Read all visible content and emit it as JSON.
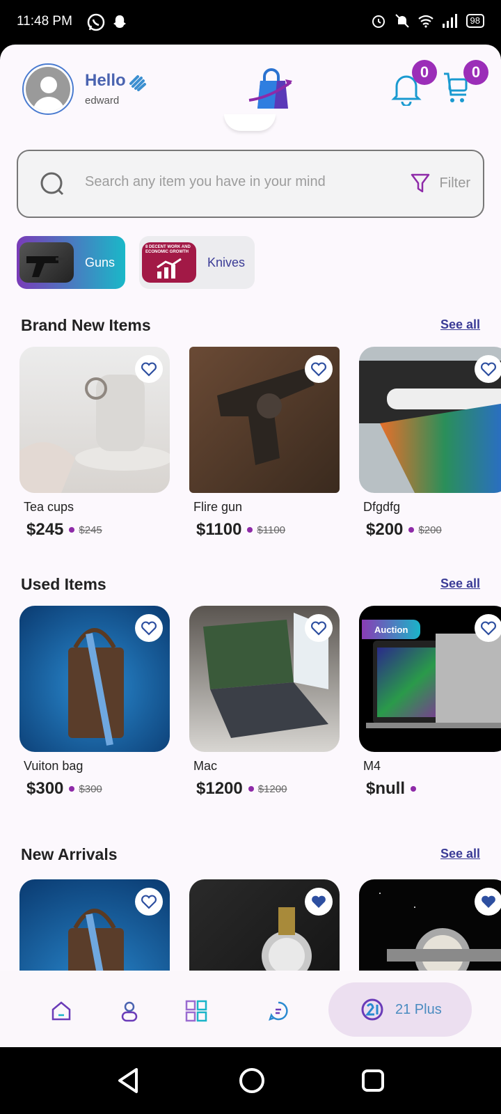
{
  "status": {
    "time": "11:48 PM",
    "battery": "98"
  },
  "header": {
    "greeting": "Hello",
    "user": "edward",
    "notifications_count": "0",
    "cart_count": "0"
  },
  "search": {
    "placeholder": "Search any item you have in your mind",
    "filter_label": "Filter"
  },
  "categories": [
    {
      "label": "Guns"
    },
    {
      "label": "Knives"
    }
  ],
  "sections": [
    {
      "title": "Brand New Items",
      "see_all": "See all",
      "items": [
        {
          "name": "Tea cups",
          "price": "$245",
          "old_price": "$245"
        },
        {
          "name": "Flire gun",
          "price": "$1100",
          "old_price": "$1100"
        },
        {
          "name": "Dfgdfg",
          "price": "$200",
          "old_price": "$200"
        }
      ]
    },
    {
      "title": "Used Items",
      "see_all": "See all",
      "items": [
        {
          "name": "Vuiton bag",
          "price": "$300",
          "old_price": "$300"
        },
        {
          "name": "Mac",
          "price": "$1200",
          "old_price": "$1200"
        },
        {
          "name": "M4",
          "price": "$null",
          "old_price": "",
          "badge": "Auction"
        }
      ]
    },
    {
      "title": "New Arrivals",
      "see_all": "See all"
    }
  ],
  "category_thumb_text": "8 DECENT WORK AND ECONOMIC GROWTH",
  "bottom_nav": {
    "pill_label": "21 Plus"
  },
  "colors": {
    "accent": "#8e2aa8",
    "link": "#3a3b96",
    "teal": "#1ab4c8"
  }
}
